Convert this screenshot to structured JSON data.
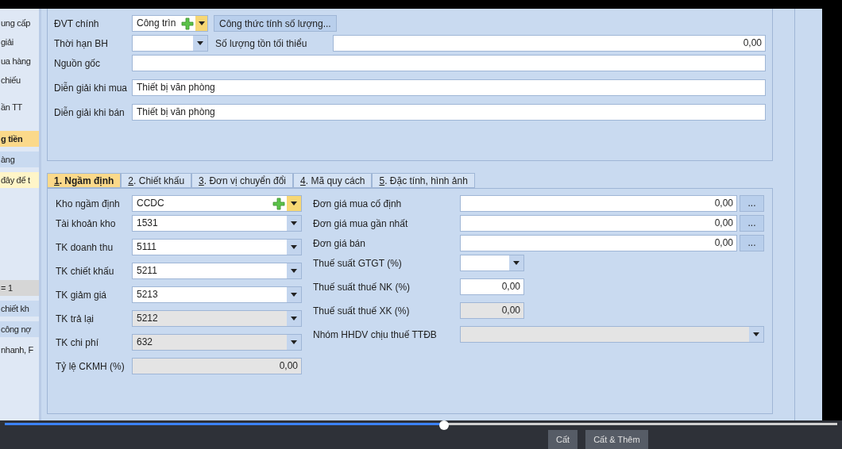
{
  "left_panel": [
    {
      "text": "ung cấp",
      "kind": "text"
    },
    {
      "text": "giải",
      "kind": "text"
    },
    {
      "text": "ua hàng",
      "kind": "text"
    },
    {
      "text": "chiếu",
      "kind": "text"
    },
    {
      "text": "ần TT",
      "kind": "field"
    },
    {
      "text": "g tiền",
      "kind": "header"
    },
    {
      "text": "àng",
      "kind": "row"
    },
    {
      "text": "đây để t",
      "kind": "filter"
    },
    {
      "text": "= 1",
      "kind": "footer"
    },
    {
      "text": "chiết kh",
      "kind": "row"
    },
    {
      "text": "công nợ",
      "kind": "row"
    },
    {
      "text": "nhanh, F",
      "kind": "text"
    }
  ],
  "top_form": {
    "unit": {
      "label": "ĐVT chính",
      "value": "Công trìn",
      "button": "Công thức tính số lượng..."
    },
    "warranty": {
      "label": "Thời hạn BH"
    },
    "min_stock": {
      "label": "Số lượng tồn tối thiểu",
      "value": "0,00"
    },
    "rows": [
      {
        "label": "Nguồn gốc",
        "value": ""
      },
      {
        "label": "Diễn giải khi mua",
        "value": "Thiết bị văn phòng"
      },
      {
        "label": "Diễn giải khi bán",
        "value": "Thiết bị văn phòng"
      }
    ]
  },
  "tabs": [
    {
      "key": "1",
      "label": ". Ngầm định",
      "selected": true
    },
    {
      "key": "2",
      "label": ". Chiết khấu",
      "selected": false
    },
    {
      "key": "3",
      "label": ". Đơn vị chuyển đổi",
      "selected": false
    },
    {
      "key": "4",
      "label": ". Mã quy cách",
      "selected": false
    },
    {
      "key": "5",
      "label": ". Đặc tính, hình ảnh",
      "selected": false
    }
  ],
  "left_fields": [
    {
      "label": "Kho ngầm định",
      "value": "CCDC",
      "kind": "add_combo",
      "disabled": false
    },
    {
      "label": "Tài khoản kho",
      "value": "1531",
      "kind": "combo",
      "disabled": false
    },
    {
      "label": "TK doanh thu",
      "value": "5111",
      "kind": "combo",
      "disabled": false
    },
    {
      "label": "TK chiết khấu",
      "value": "5211",
      "kind": "combo",
      "disabled": false
    },
    {
      "label": "TK giảm giá",
      "value": "5213",
      "kind": "combo",
      "disabled": false
    },
    {
      "label": "TK trả lại",
      "value": "5212",
      "kind": "combo",
      "disabled": true
    },
    {
      "label": "TK chi phí",
      "value": "632",
      "kind": "combo",
      "disabled": true
    },
    {
      "label": "Tỷ lệ CKMH (%)",
      "value": "0,00",
      "kind": "number",
      "disabled": true
    }
  ],
  "right_fields": [
    {
      "label": "Đơn giá mua cố định",
      "value": "0,00",
      "kind": "price",
      "button": "...",
      "disabled": false
    },
    {
      "label": "Đơn giá mua gần nhất",
      "value": "0,00",
      "kind": "price",
      "button": "...",
      "disabled": false
    },
    {
      "label": "Đơn giá bán",
      "value": "0,00",
      "kind": "price",
      "button": "...",
      "disabled": false
    },
    {
      "label": "Thuế suất GTGT (%)",
      "kind": "small_combo",
      "disabled": false
    },
    {
      "label": "Thuế suất thuế NK (%)",
      "value": "0,00",
      "kind": "small_number",
      "disabled": false
    },
    {
      "label": "Thuế suất thuế XK (%)",
      "value": "0,00",
      "kind": "small_number",
      "disabled": true
    },
    {
      "label": "Nhóm HHDV chịu thuế TTĐB",
      "kind": "wide_combo",
      "disabled": true
    }
  ],
  "toolbar": [
    {
      "label": "Cất"
    },
    {
      "label": "Cất & Thêm"
    }
  ],
  "video_progress": {
    "level": 0.527
  }
}
